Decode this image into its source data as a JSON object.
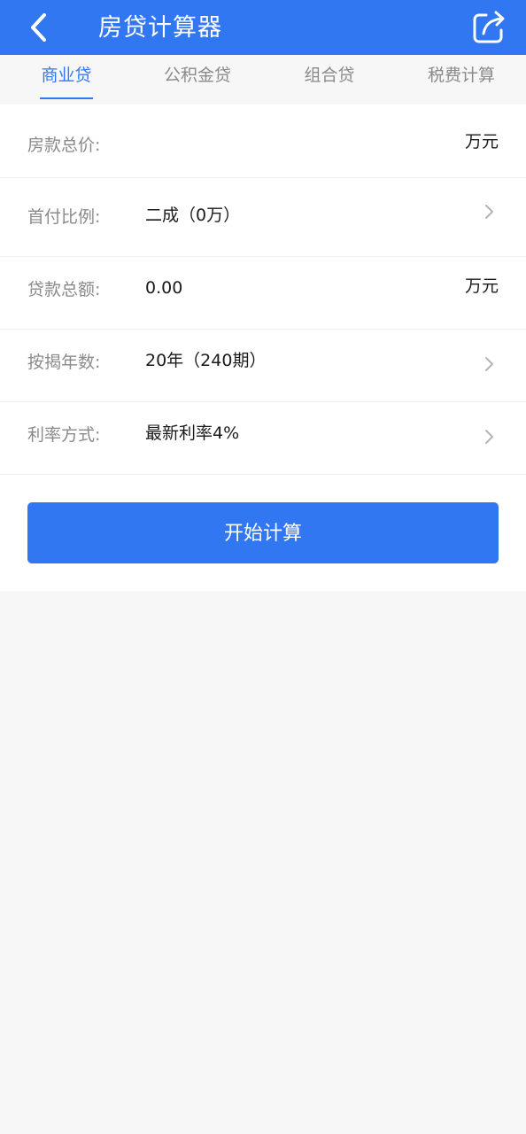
{
  "header": {
    "title": "房贷计算器",
    "back_icon": "chevron-left-icon",
    "share_icon": "share-icon",
    "color": "#3277f2"
  },
  "tabs": [
    {
      "label": "商业贷",
      "active": true
    },
    {
      "label": "公积金贷",
      "active": false
    },
    {
      "label": "组合贷",
      "active": false
    },
    {
      "label": "税费计算",
      "active": false
    }
  ],
  "form": {
    "rows": [
      {
        "label": "房款总价:",
        "value": "",
        "unit": "万元"
      },
      {
        "label": "首付比例:",
        "value": "二成（0万）"
      },
      {
        "label": "贷款总额:",
        "value": "0.00",
        "unit": "万元"
      },
      {
        "label": "按揭年数:",
        "value": "20年（240期）"
      },
      {
        "label": "利率方式:",
        "value": "最新利率4%"
      }
    ]
  },
  "actions": {
    "calculate_label": "开始计算"
  },
  "colors": {
    "accent": "#3277f2",
    "page_background": "#f7f7f7"
  }
}
